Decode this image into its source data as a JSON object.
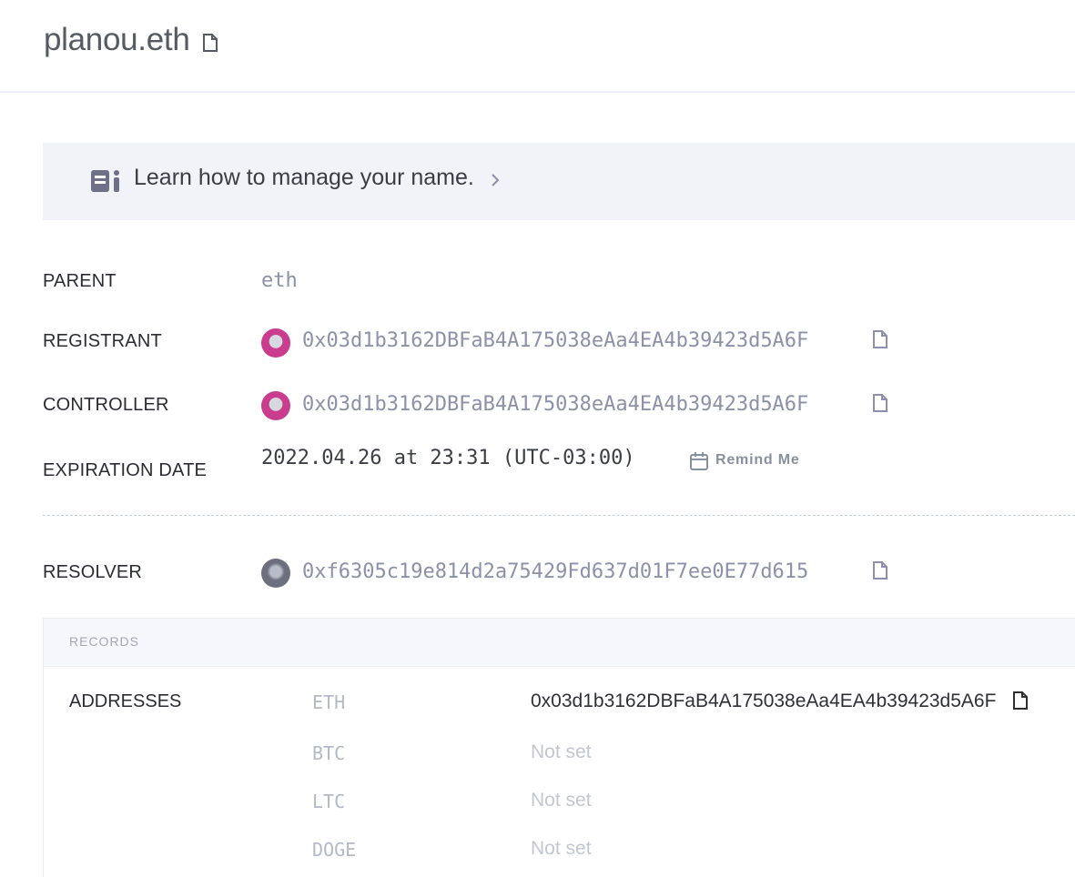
{
  "header": {
    "title": "planou.eth"
  },
  "banner": {
    "text": "Learn how to manage your name."
  },
  "details": {
    "parent_label": "PARENT",
    "parent_value": "eth",
    "registrant_label": "REGISTRANT",
    "registrant_value": "0x03d1b3162DBFaB4A175038eAa4EA4b39423d5A6F",
    "controller_label": "CONTROLLER",
    "controller_value": "0x03d1b3162DBFaB4A175038eAa4EA4b39423d5A6F",
    "expiration_label": "EXPIRATION DATE",
    "expiration_value": "2022.04.26 at 23:31 (UTC-03:00)",
    "remind_label": "Remind Me",
    "resolver_label": "RESOLVER",
    "resolver_value": "0xf6305c19e814d2a75429Fd637d01F7ee0E77d615"
  },
  "records": {
    "section_label": "RECORDS",
    "addresses_label": "ADDRESSES",
    "addresses": [
      {
        "coin": "ETH",
        "value": "0x03d1b3162DBFaB4A175038eAa4EA4b39423d5A6F"
      },
      {
        "coin": "BTC",
        "value": "Not set"
      },
      {
        "coin": "LTC",
        "value": "Not set"
      },
      {
        "coin": "DOGE",
        "value": "Not set"
      }
    ]
  },
  "colors": {
    "accent_pink": "#c93c8e",
    "muted_value": "#8c90a8",
    "banner_bg": "#f1f3f8"
  },
  "icons": [
    "copy-icon",
    "book-icon",
    "chevron-right-icon",
    "calendar-icon",
    "avatar-icon"
  ]
}
